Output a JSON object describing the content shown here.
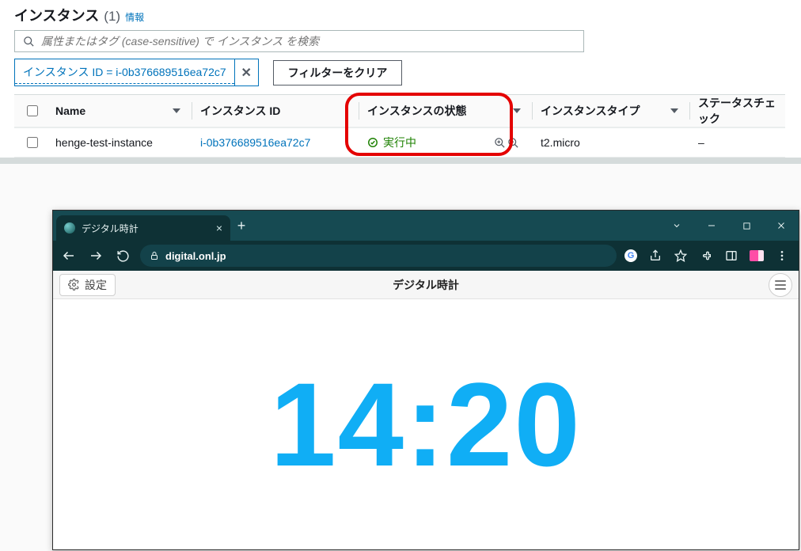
{
  "aws": {
    "title": "インスタンス",
    "count": "(1)",
    "info_link": "情報",
    "search_placeholder": "属性またはタグ (case-sensitive) で インスタンス を検索",
    "filter_chip": "インスタンス ID = i-0b376689516ea72c7",
    "clear_filters": "フィルターをクリア",
    "columns": {
      "name": "Name",
      "instance_id": "インスタンス ID",
      "state": "インスタンスの状態",
      "type": "インスタンスタイプ",
      "status_check": "ステータスチェック"
    },
    "rows": [
      {
        "name": "henge-test-instance",
        "instance_id": "i-0b376689516ea72c7",
        "state": "実行中",
        "type": "t2.micro",
        "status_check": "–"
      }
    ]
  },
  "browser": {
    "tab_title": "デジタル時計",
    "url_domain": "digital.onl.jp",
    "page_header": "デジタル時計",
    "settings_label": "設定",
    "clock_time": "14:20"
  }
}
